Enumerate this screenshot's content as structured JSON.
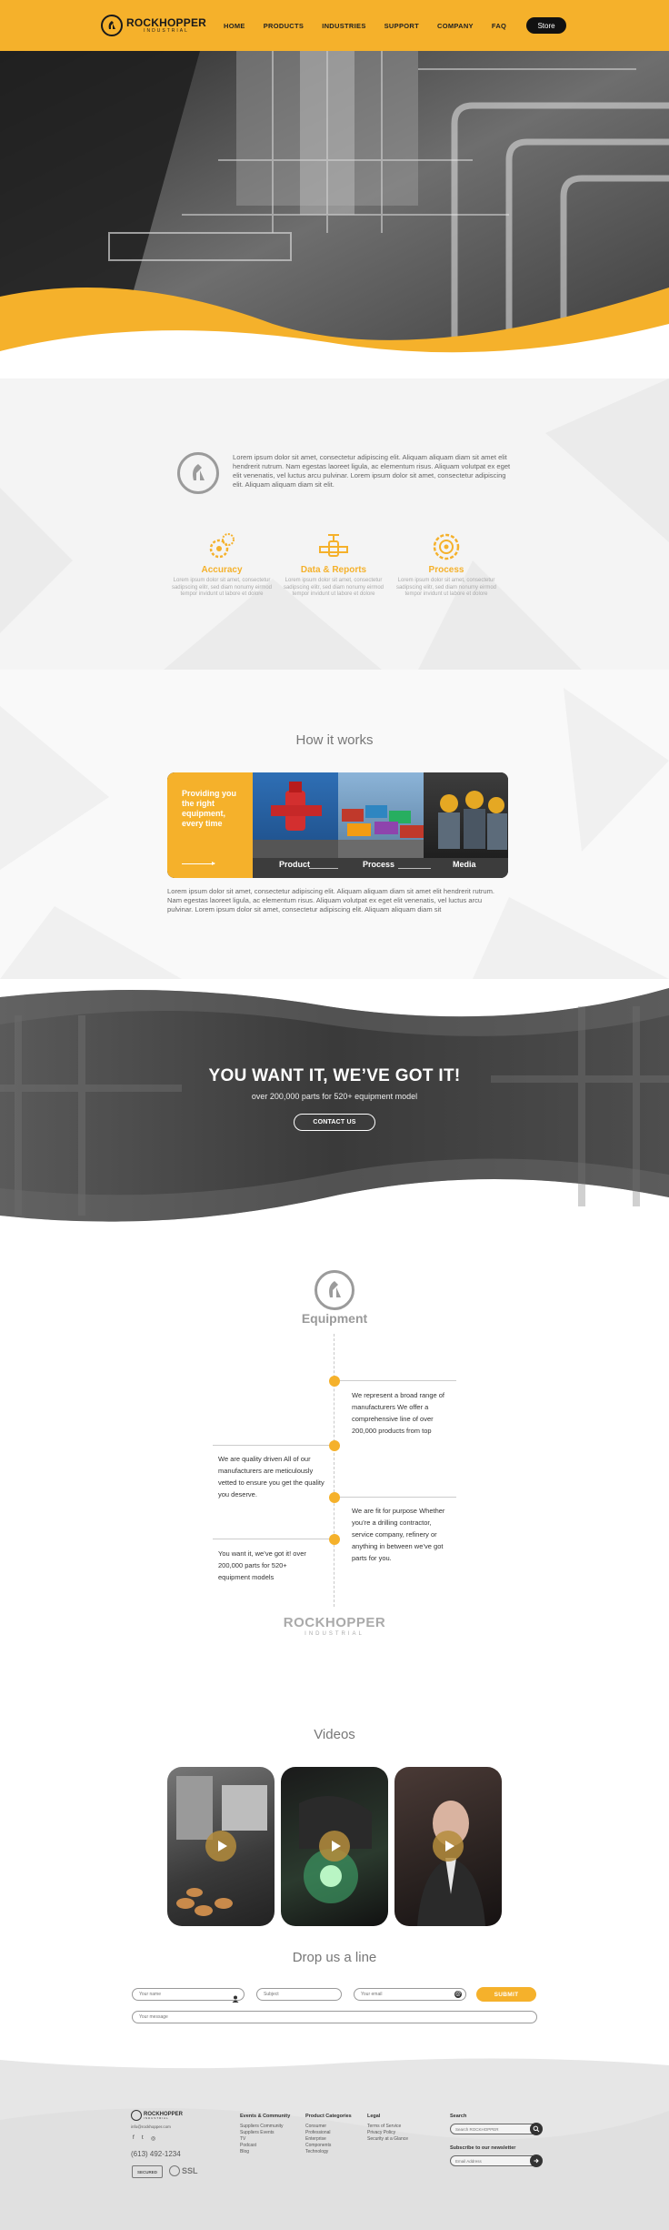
{
  "brand": {
    "name": "ROCKHOPPER",
    "tagline": "INDUSTRIAL"
  },
  "nav": {
    "items": [
      "HOME",
      "PRODUCTS",
      "INDUSTRIES",
      "SUPPORT",
      "COMPANY",
      "FAQ"
    ],
    "store_label": "Store"
  },
  "intro": {
    "text": "Lorem ipsum dolor sit amet, consectetur adipiscing elit. Aliquam aliquam diam sit amet elit hendrerit rutrum. Nam egestas laoreet ligula, ac elementum risus. Aliquam volutpat ex eget elit venenatis, vel luctus arcu pulvinar. Lorem ipsum dolor sit amet, consectetur adipiscing elit. Aliquam aliquam diam sit elit.",
    "features": [
      {
        "title": "Accuracy",
        "desc": "Lorem ipsum dolor sit amet, consectetur sadipscing elitr, sed diam nonumy eirmod tempor invidunt ut labore et dolore"
      },
      {
        "title": "Data & Reports",
        "desc": "Lorem ipsum dolor sit amet, consectetur sadipscing elitr, sed diam nonumy eirmod tempor invidunt ut labore et dolore"
      },
      {
        "title": "Process",
        "desc": "Lorem ipsum dolor sit amet, consectetur sadipscing elitr, sed diam nonumy eirmod tempor invidunt ut labore et dolore"
      }
    ]
  },
  "how": {
    "title": "How it works",
    "card_text": "Providing you the right equipment, every time",
    "labels": [
      "Product",
      "Process",
      "Media"
    ],
    "text": "Lorem ipsum dolor sit amet, consectetur adipiscing elit. Aliquam aliquam diam sit amet elit hendrerit rutrum. Nam egestas laoreet ligula, ac elementum risus. Aliquam volutpat ex eget elit venenatis, vel luctus arcu pulvinar. Lorem ipsum dolor sit amet, consectetur adipiscing elit. Aliquam aliquam diam sit"
  },
  "banner": {
    "title": "YOU WANT IT, WE’VE GOT IT!",
    "subtitle": "over 200,000 parts for 520+ equipment model",
    "button": "CONTACT US"
  },
  "equipment": {
    "title": "Equipment",
    "items": [
      "We represent a broad range of manufacturers We offer a comprehensive line of over 200,000 products from top",
      "We are quality driven All of our manufacturers are meticulously vetted to ensure you get the quality you deserve.",
      "We are fit for purpose Whether you’re a drilling contractor, service company, refinery or anything in between we’ve got parts for you.",
      "You want it, we’ve got it! over 200,000 parts for 520+ equipment models"
    ]
  },
  "videos": {
    "title": "Videos"
  },
  "contact": {
    "title": "Drop us a line",
    "name_placeholder": "Your name",
    "subject_placeholder": "Subject",
    "email_placeholder": "Your email",
    "message_placeholder": "Your message",
    "submit": "SUBMIT"
  },
  "footer": {
    "email": "info@rockhopper.com",
    "phone": "(613) 492-1234",
    "badge_left": "SECURED",
    "badge_right": "SSL",
    "columns": [
      {
        "heading": "Events & Community",
        "items": [
          "Suppliers Community",
          "Suppliers Events",
          "TV",
          "Podcast",
          "Blog"
        ]
      },
      {
        "heading": "Product Categories",
        "items": [
          "Consumer",
          "Professional",
          "Enterprise",
          "Components",
          "Technology"
        ]
      },
      {
        "heading": "Legal",
        "items": [
          "Terms of Service",
          "Privacy Policy",
          "Security at a Glance"
        ]
      }
    ],
    "search_heading": "Search",
    "search_placeholder": "Search ROCKHOPPER",
    "newsletter_heading": "Subscribe to our newsletter",
    "newsletter_placeholder": "Email Address"
  },
  "colors": {
    "accent": "#f5b12b",
    "dark": "#1a1a1a"
  }
}
